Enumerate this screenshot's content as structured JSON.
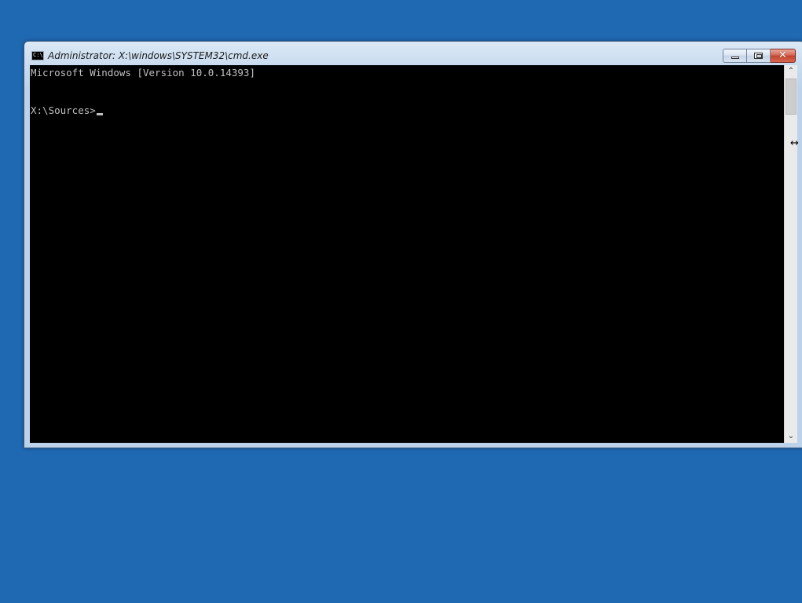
{
  "window": {
    "title": "Administrator: X:\\windows\\SYSTEM32\\cmd.exe",
    "icon": "cmd-icon",
    "buttons": {
      "minimize": "minimize-icon",
      "maximize": "restore-icon",
      "close": "✕"
    }
  },
  "console": {
    "lines": [
      "Microsoft Windows [Version 10.0.14393]",
      "X:\\Sources>"
    ],
    "background": "#000000",
    "foreground": "#c0c0c0"
  },
  "scrollbar": {
    "up_arrow": "⌃",
    "down_arrow": "⌄"
  },
  "desktop": {
    "background": "#1f68b2"
  },
  "cursor": {
    "icon": "horizontal-resize-cursor",
    "glyph": "↔"
  }
}
